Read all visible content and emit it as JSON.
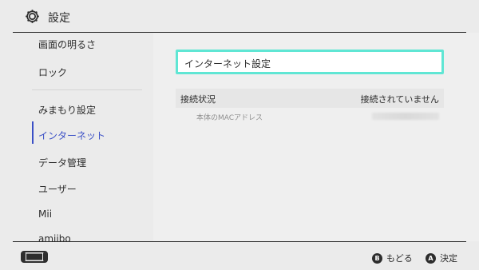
{
  "header": {
    "title": "設定",
    "icon": "gear-icon"
  },
  "sidebar": {
    "items": [
      {
        "label": "画面の明るさ"
      },
      {
        "label": "ロック"
      },
      {
        "label": "みまもり設定"
      },
      {
        "label": "インターネット",
        "active": true
      },
      {
        "label": "データ管理"
      },
      {
        "label": "ユーザー"
      },
      {
        "label": "Mii"
      },
      {
        "label": "amiibo"
      }
    ]
  },
  "main": {
    "internet_settings_label": "インターネット設定",
    "connection_status_label": "接続状況",
    "connection_status_value": "接続されていません",
    "mac_address_label": "本体のMACアドレス"
  },
  "footer": {
    "back_button_glyph": "B",
    "back_label": "もどる",
    "ok_button_glyph": "A",
    "ok_label": "決定"
  },
  "colors": {
    "accent": "#3a4fc6",
    "focus_border": "#5fe6d4",
    "background": "#ebebeb",
    "text": "#2d2d2d"
  }
}
